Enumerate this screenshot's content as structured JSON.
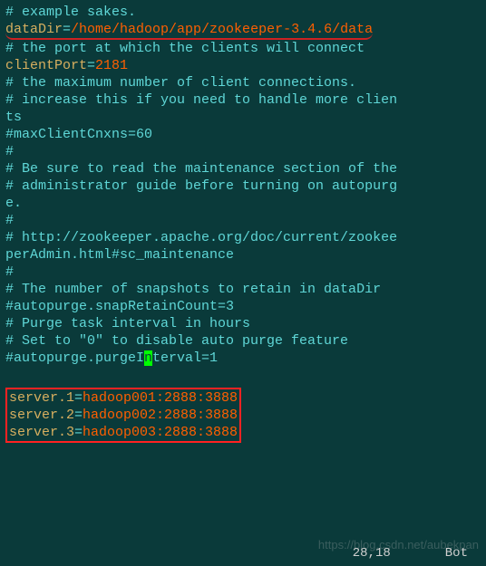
{
  "lines": {
    "l1": "# example sakes.",
    "l2_key": "dataDir",
    "l2_eq": "=",
    "l2_val": "/home/hadoop/app/zookeeper-3.4.6/data",
    "l3": "# the port at which the clients will connect",
    "l4_key": "clientPort",
    "l4_eq": "=",
    "l4_val": "2181",
    "l5": "# the maximum number of client connections.",
    "l6": "# increase this if you need to handle more clien",
    "l7": "ts",
    "l8": "#maxClientCnxns=60",
    "l9": "#",
    "l10": "# Be sure to read the maintenance section of the",
    "l11": "",
    "l12": "# administrator guide before turning on autopurg",
    "l13": "e.",
    "l14": "#",
    "l15": "# http://zookeeper.apache.org/doc/current/zookee",
    "l16": "perAdmin.html#sc_maintenance",
    "l17": "#",
    "l18": "# The number of snapshots to retain in dataDir",
    "l19": "#autopurge.snapRetainCount=3",
    "l20": "# Purge task interval in hours",
    "l21": "# Set to \"0\" to disable auto purge feature",
    "l22_a": "#autopurge.purgeI",
    "l22_cursor": "n",
    "l22_b": "terval=1",
    "s1_key": "server.1",
    "s1_val": "hadoop001:2888:3888",
    "s2_key": "server.2",
    "s2_val": "hadoop002:2888:3888",
    "s3_key": "server.3",
    "s3_val": "hadoop003:2888:3888"
  },
  "status": {
    "pos": "28,18",
    "loc": "Bot"
  },
  "watermark": "https://blog.csdn.net/aubekpan"
}
